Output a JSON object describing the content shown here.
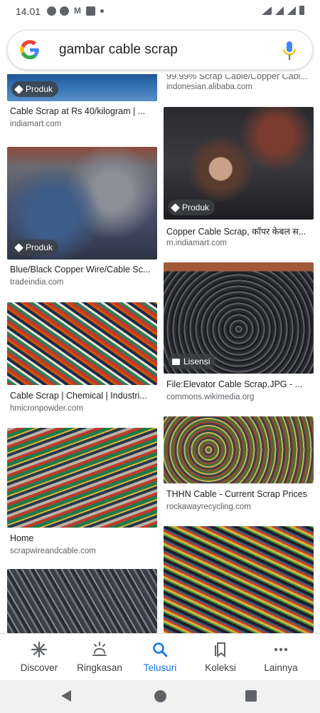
{
  "status_bar": {
    "time": "14.01",
    "icons": [
      "whatsapp-icon",
      "messages-icon",
      "gmail-icon",
      "mail-icon",
      "dot-icon",
      "wifi-icon",
      "signal-icon",
      "signal-icon",
      "battery-icon"
    ]
  },
  "search": {
    "query": "gambar cable scrap",
    "logo": "google-g-icon",
    "mic": "microphone-icon"
  },
  "results": [
    {
      "title": "Cable Scrap at Rs 40/kilogram | ...",
      "source": "indiamart.com",
      "badge": "Produk"
    },
    {
      "title": "99.99% Scrap Cable/Copper Cabl...",
      "source": "indonesian.alibaba.com",
      "badge": ""
    },
    {
      "title": "Blue/Black Copper Wire/Cable Sc...",
      "source": "tradeindia.com",
      "badge": "Produk"
    },
    {
      "title": "Copper Cable Scrap, कॉपर केबल स...",
      "source": "m.indiamart.com",
      "badge": "Produk"
    },
    {
      "title": "Cable Scrap | Chemical | Industri...",
      "source": "hmicronpowder.com",
      "badge": ""
    },
    {
      "title": "File:Elevator Cable Scrap.JPG - ...",
      "source": "commons.wikimedia.org",
      "badge": "Lisensi"
    },
    {
      "title": "Home",
      "source": "scrapwireandcable.com",
      "badge": ""
    },
    {
      "title": "THHN Cable - Current Scrap Prices",
      "source": "rockawayrecycling.com",
      "badge": ""
    },
    {
      "title": "",
      "source": "",
      "badge": ""
    },
    {
      "title": "",
      "source": "",
      "badge": ""
    }
  ],
  "bottom_nav": [
    {
      "label": "Discover",
      "icon": "asterisk-icon",
      "active": false
    },
    {
      "label": "Ringkasan",
      "icon": "snapshot-icon",
      "active": false
    },
    {
      "label": "Telusuri",
      "icon": "search-icon",
      "active": true
    },
    {
      "label": "Koleksi",
      "icon": "bookmark-icon",
      "active": false
    },
    {
      "label": "Lainnya",
      "icon": "more-dots-icon",
      "active": false
    }
  ],
  "colors": {
    "accent": "#1a73e8",
    "google_blue": "#4285f4",
    "google_red": "#ea4335",
    "google_yellow": "#fbbc05",
    "google_green": "#34a853"
  }
}
